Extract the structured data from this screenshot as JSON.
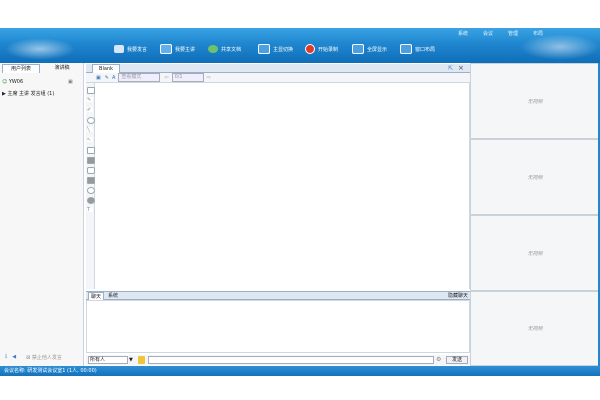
{
  "top_menu": [
    "系统",
    "会议",
    "管理",
    "布局"
  ],
  "toolbar": [
    {
      "label": "我要发言",
      "icon": "microphone-icon",
      "color": "#d8e6f5"
    },
    {
      "label": "我要主讲",
      "icon": "presenter-icon",
      "color": "#5fb0ee"
    },
    {
      "label": "共享文档",
      "icon": "share-docs-icon",
      "color": "#6cc36c"
    },
    {
      "label": "主显切换",
      "icon": "display-switch-icon",
      "color": "#4aa0e0"
    },
    {
      "label": "开始录制",
      "icon": "record-icon",
      "color": "#e03a2a"
    },
    {
      "label": "全屏显示",
      "icon": "fullscreen-icon",
      "color": "#4aa0e0"
    },
    {
      "label": "窗口布局",
      "icon": "window-layout-icon",
      "color": "#4aa0e0"
    }
  ],
  "left": {
    "tabs": [
      "用户列表",
      "演讲稿"
    ],
    "user_name": "YW06",
    "group_label": "主席 主讲 发言组 (1)",
    "stop_button": "禁止他人发言"
  },
  "doc": {
    "tab_label": "Blank",
    "mode_select": "查看模式",
    "page_indicator": "0/1"
  },
  "chat": {
    "tabs": [
      "聊天",
      "系统"
    ],
    "hide_label": "隐藏聊天",
    "recipient": "所有人",
    "send_label": "发送"
  },
  "video": {
    "panels": [
      "无视频",
      "无视频",
      "无视频",
      "无视频"
    ]
  },
  "status": {
    "text": "会议名称: 研发测试会议室1 (1人, 00:00)"
  }
}
